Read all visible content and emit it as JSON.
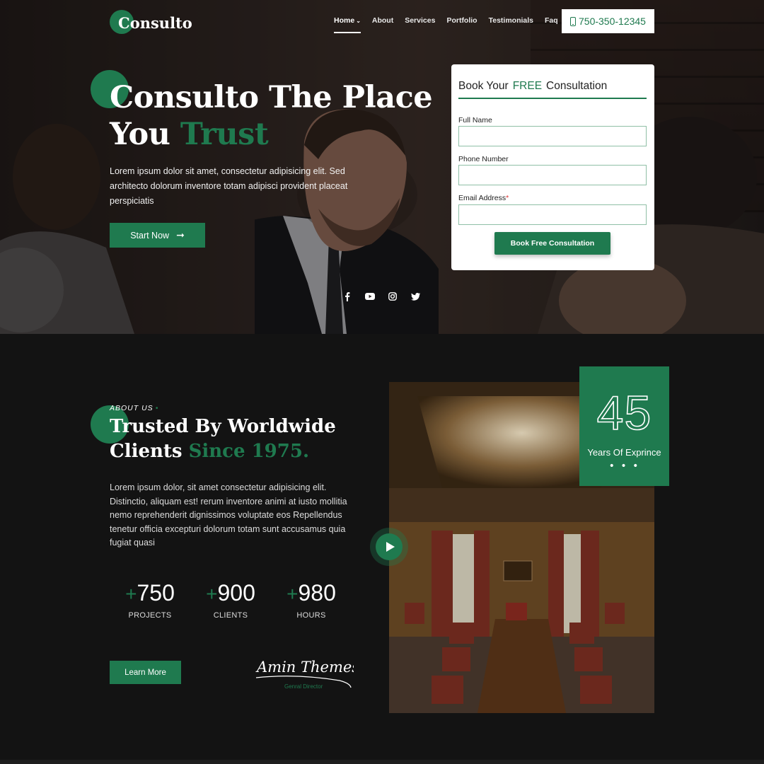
{
  "brand": {
    "logo_text": "Consulto",
    "accent_color": "#1f7a4f"
  },
  "nav": {
    "items": [
      {
        "label": "Home",
        "active": true,
        "has_dropdown": true
      },
      {
        "label": "About",
        "active": false
      },
      {
        "label": "Services",
        "active": false
      },
      {
        "label": "Portfolio",
        "active": false
      },
      {
        "label": "Testimonials",
        "active": false
      },
      {
        "label": "Faq",
        "active": false
      }
    ],
    "phone": "750-350-12345",
    "phone_icon": "mobile-phone-icon"
  },
  "hero": {
    "title_line1": "Consulto The Place",
    "title_line2_prefix": "You",
    "title_line2_highlight": "Trust",
    "description": "Lorem ipsum dolor sit amet, consectetur adipisicing elit. Sed architecto dolorum inventore totam adipisci provident placeat perspiciatis",
    "cta_label": "Start Now",
    "cta_icon": "arrow-right-icon",
    "socials": [
      "facebook-icon",
      "youtube-icon",
      "instagram-icon",
      "twitter-icon"
    ]
  },
  "form": {
    "title_prefix": "Book Your",
    "title_highlight": "FREE",
    "title_suffix": "Consultation",
    "fields": [
      {
        "label": "Full Name",
        "required": false,
        "value": ""
      },
      {
        "label": "Phone Number",
        "required": false,
        "value": ""
      },
      {
        "label": "Email Address",
        "required": true,
        "value": ""
      }
    ],
    "required_marker": "*",
    "submit_label": "Book Free Consultation"
  },
  "about": {
    "eyebrow": "ABOUT US",
    "title_line1": "Trusted By Worldwide",
    "title_line2_prefix": "Clients",
    "title_line2_highlight": "Since 1975.",
    "description": "Lorem ipsum dolor, sit amet consectetur adipisicing elit. Distinctio, aliquam est! rerum inventore animi at iusto mollitia nemo reprehenderit dignissimos voluptate eos Repellendus tenetur officia excepturi dolorum totam sunt accusamus quia fugiat quasi",
    "stats": [
      {
        "prefix": "+",
        "value": "750",
        "label": "PROJECTS"
      },
      {
        "prefix": "+",
        "value": "900",
        "label": "CLIENTS"
      },
      {
        "prefix": "+",
        "value": "980",
        "label": "HOURS"
      }
    ],
    "learn_more_label": "Learn More",
    "signature_text": "Amin Themes",
    "signature_role": "Genral Director",
    "experience": {
      "number": "45",
      "label": "Years Of Exprince",
      "dots": "• • •"
    },
    "play_icon": "play-icon"
  }
}
